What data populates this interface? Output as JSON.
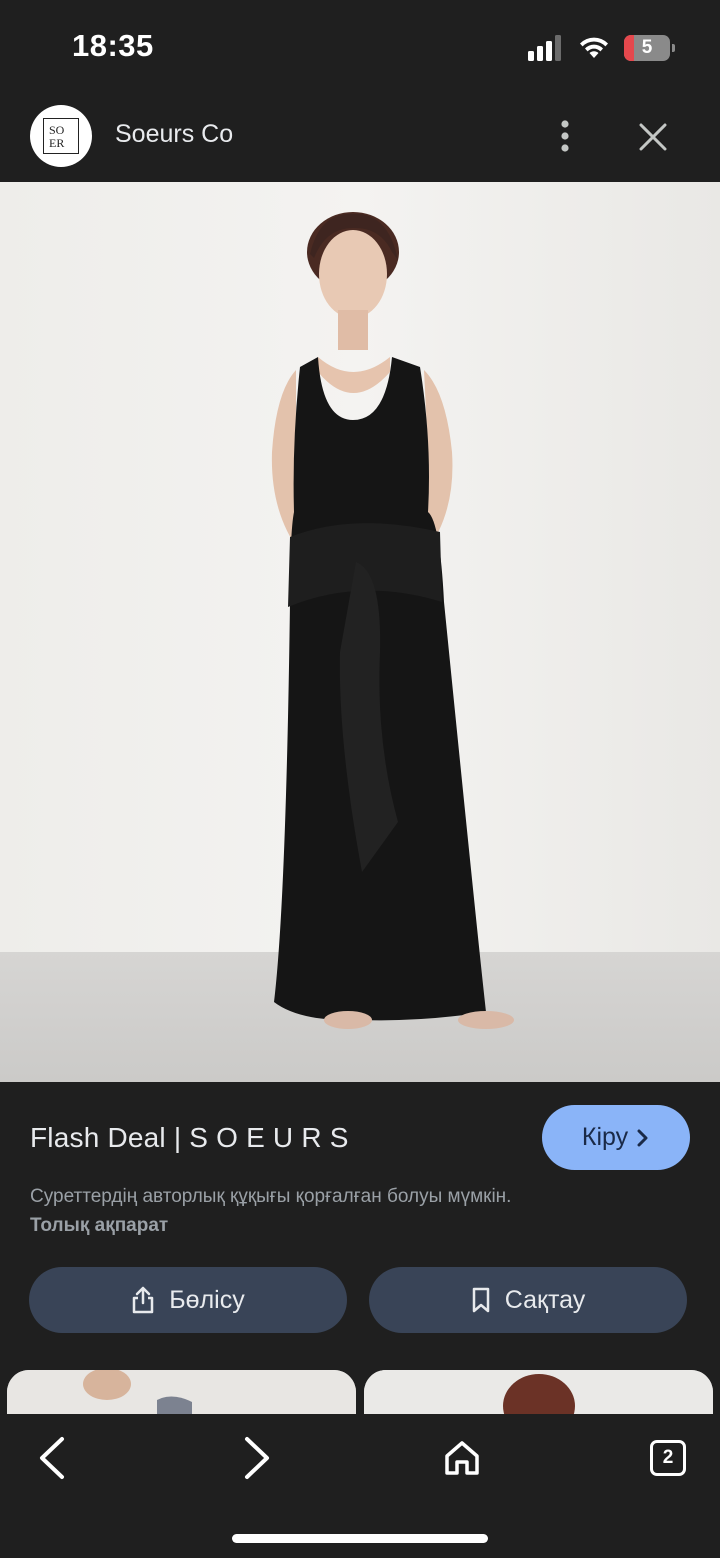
{
  "status_bar": {
    "time": "18:35",
    "battery_level": "5",
    "icons": [
      "cellular-signal-icon",
      "wifi-icon",
      "battery-icon"
    ]
  },
  "header": {
    "site_name": "Soeurs Co",
    "logo_text": "SOEURS",
    "icons": [
      "more-vert-icon",
      "close-icon"
    ]
  },
  "product": {
    "title": "Flash Deal | S O E U R S",
    "visit_label": "Кіру",
    "copyright_text": "Суреттердің авторлық құқығы қорғалған болуы мүмкін.",
    "more_info_label": "Толық ақпарат",
    "share_label": "Бөлісу",
    "save_label": "Сақтау"
  },
  "bottom_nav": {
    "tab_count": "2",
    "icons": [
      "back-arrow-icon",
      "forward-arrow-icon",
      "home-icon",
      "tabs-icon"
    ]
  },
  "colors": {
    "background": "#1f1f1f",
    "accent": "#8ab4f8",
    "action_button": "#394457",
    "muted_text": "#9aa0a6",
    "battery_low": "#e5484d"
  }
}
